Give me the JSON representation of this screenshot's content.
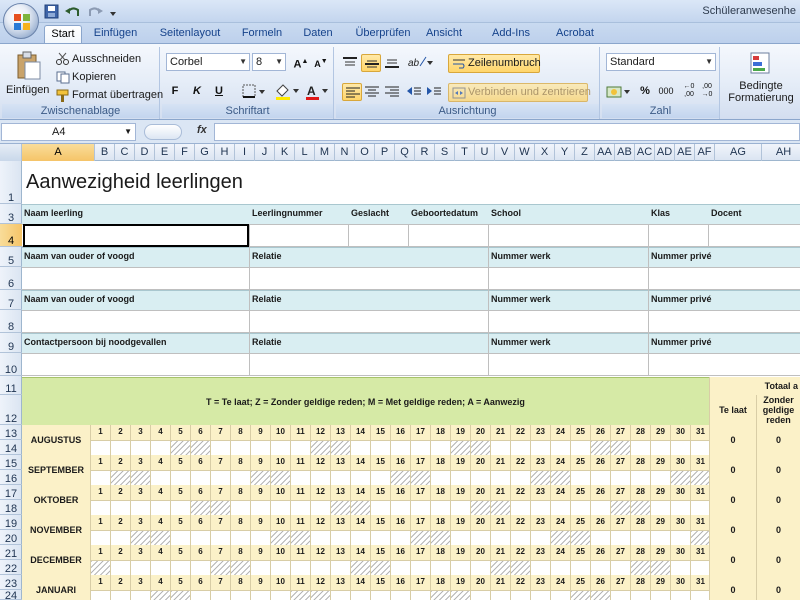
{
  "app": {
    "title": "Schüleranwesenhe",
    "quick_access": [
      "save-icon",
      "undo-icon",
      "redo-icon",
      "customize-icon"
    ]
  },
  "ribbon": {
    "tabs": [
      "Start",
      "Einfügen",
      "Seitenlayout",
      "Formeln",
      "Daten",
      "Überprüfen",
      "Ansicht",
      "Add-Ins",
      "Acrobat"
    ],
    "active_tab": "Start",
    "clipboard": {
      "group_label": "Zwischenablage",
      "paste": "Einfügen",
      "cut": "Ausschneiden",
      "copy": "Kopieren",
      "format_painter": "Format übertragen"
    },
    "font": {
      "group_label": "Schriftart",
      "font_name": "Corbel",
      "font_size": "8",
      "bold": "F",
      "italic": "K",
      "underline": "U"
    },
    "alignment": {
      "group_label": "Ausrichtung",
      "wrap_text": "Zeilenumbruch",
      "merge_center": "Verbinden und zentrieren"
    },
    "number": {
      "group_label": "Zahl",
      "format": "Standard",
      "percent": "%",
      "thousands": "000"
    },
    "styles": {
      "conditional_format": "Bedingte Formatierung"
    }
  },
  "formula_bar": {
    "name_box": "A4",
    "fx": "fx",
    "formula": ""
  },
  "grid": {
    "columns": [
      "A",
      "B",
      "C",
      "D",
      "E",
      "F",
      "G",
      "H",
      "I",
      "J",
      "K",
      "L",
      "M",
      "N",
      "O",
      "P",
      "Q",
      "R",
      "S",
      "T",
      "U",
      "V",
      "W",
      "X",
      "Y",
      "Z",
      "AA",
      "AB",
      "AC",
      "AD",
      "AE",
      "AF",
      "AG",
      "AH"
    ],
    "selected_column": "A",
    "rows": [
      "1",
      "3",
      "4",
      "5",
      "6",
      "7",
      "8",
      "9",
      "10",
      "11",
      "12",
      "13",
      "14",
      "15",
      "16",
      "17",
      "18",
      "19",
      "20",
      "21",
      "22",
      "23",
      "24"
    ],
    "selected_row": "4"
  },
  "sheet": {
    "title": "Aanwezigheid leerlingen",
    "student_headers": [
      "Naam leerling",
      "Leerlingnummer",
      "Geslacht",
      "Geboortedatum",
      "School",
      "Klas",
      "Docent"
    ],
    "parent_rows": [
      [
        "Naam van ouder of voogd",
        "Relatie",
        "Nummer werk",
        "Nummer privé"
      ],
      [
        "Naam van ouder of voogd",
        "Relatie",
        "Nummer werk",
        "Nummer privé"
      ],
      [
        "Contactpersoon bij noodgevallen",
        "Relatie",
        "Nummer werk",
        "Nummer privé"
      ]
    ],
    "legend": "T = Te laat; Z = Zonder geldige reden; M = Met geldige reden; A = Aanwezig",
    "totals_header": "Totaal a",
    "total_columns": [
      "Te laat",
      "Zonder geldige reden"
    ],
    "days": [
      "1",
      "2",
      "3",
      "4",
      "5",
      "6",
      "7",
      "8",
      "9",
      "10",
      "11",
      "12",
      "13",
      "14",
      "15",
      "16",
      "17",
      "18",
      "19",
      "20",
      "21",
      "22",
      "23",
      "24",
      "25",
      "26",
      "27",
      "28",
      "29",
      "30",
      "31"
    ],
    "months": [
      {
        "name": "AUGUSTUS",
        "t": "0",
        "z": "0"
      },
      {
        "name": "SEPTEMBER",
        "t": "0",
        "z": "0"
      },
      {
        "name": "OKTOBER",
        "t": "0",
        "z": "0"
      },
      {
        "name": "NOVEMBER",
        "t": "0",
        "z": "0"
      },
      {
        "name": "DECEMBER",
        "t": "0",
        "z": "0"
      },
      {
        "name": "JANUARI",
        "t": "0",
        "z": "0"
      }
    ]
  }
}
